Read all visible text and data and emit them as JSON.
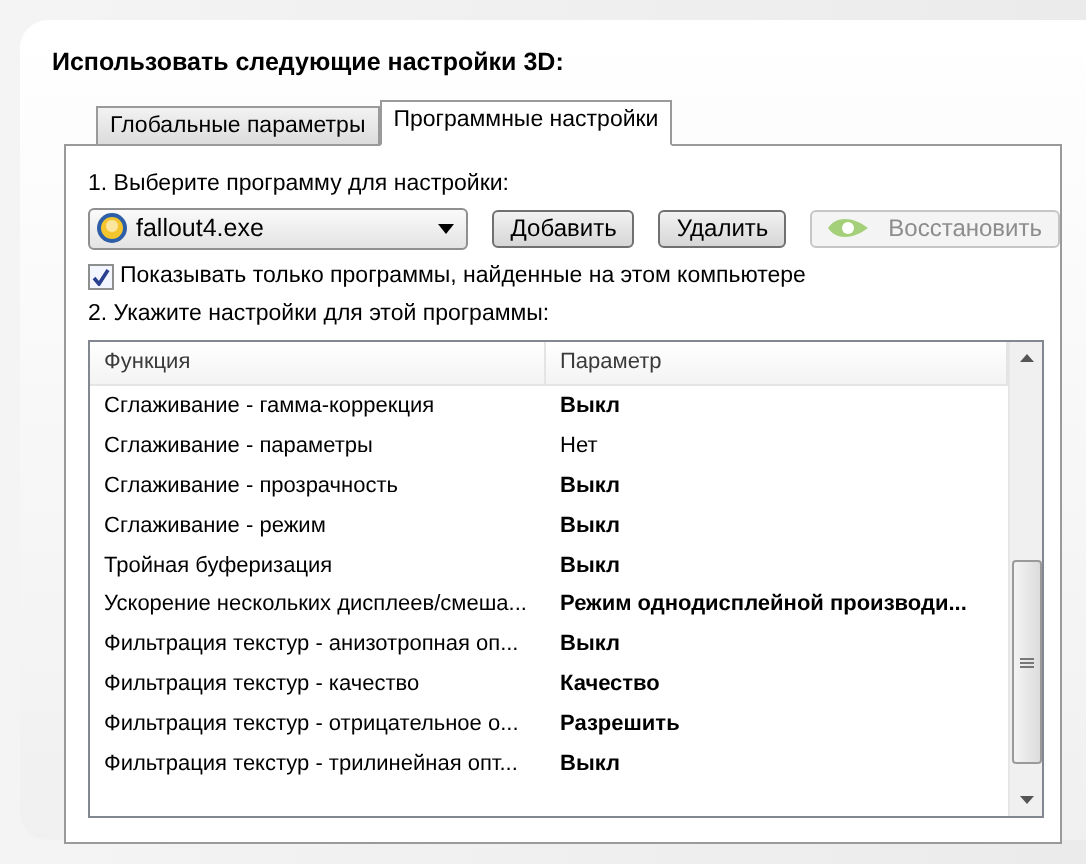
{
  "title": "Использовать следующие настройки 3D:",
  "tabs": [
    {
      "label": "Глобальные параметры",
      "selected": false
    },
    {
      "label": "Программные настройки",
      "selected": true
    }
  ],
  "step1_label": "1. Выберите программу для настройки:",
  "program_select": {
    "value": "fallout4.exe"
  },
  "buttons": [
    {
      "label": "Добавить",
      "disabled": false,
      "kind": "text"
    },
    {
      "label": "Удалить",
      "disabled": false,
      "kind": "text"
    },
    {
      "label": "Восстановить",
      "disabled": true,
      "kind": "logo"
    }
  ],
  "show_only_found": {
    "label": "Показывать только программы, найденные на этом компьютере",
    "checked": true
  },
  "step2_label": "2. Укажите настройки для этой программы:",
  "table": {
    "columns": [
      "Функция",
      "Параметр"
    ],
    "rows": [
      {
        "function": "Сглаживание - гамма-коррекция",
        "value": "Выкл",
        "bold": true
      },
      {
        "function": "Сглаживание - параметры",
        "value": "Нет",
        "bold": false
      },
      {
        "function": "Сглаживание - прозрачность",
        "value": "Выкл",
        "bold": true
      },
      {
        "function": "Сглаживание - режим",
        "value": "Выкл",
        "bold": true
      },
      {
        "function": "Тройная буферизация",
        "value": "Выкл",
        "bold": true
      },
      {
        "function": "Ускорение нескольких дисплеев/смеша...",
        "value": "Режим однодисплейной производи...",
        "bold": true
      },
      {
        "function": "Фильтрация текстур - анизотропная оп...",
        "value": "Выкл",
        "bold": true
      },
      {
        "function": "Фильтрация текстур - качество",
        "value": "Качество",
        "bold": true
      },
      {
        "function": "Фильтрация текстур - отрицательное о...",
        "value": "Разрешить",
        "bold": true
      },
      {
        "function": "Фильтрация текстур - трилинейная опт...",
        "value": "Выкл",
        "bold": true
      }
    ]
  }
}
